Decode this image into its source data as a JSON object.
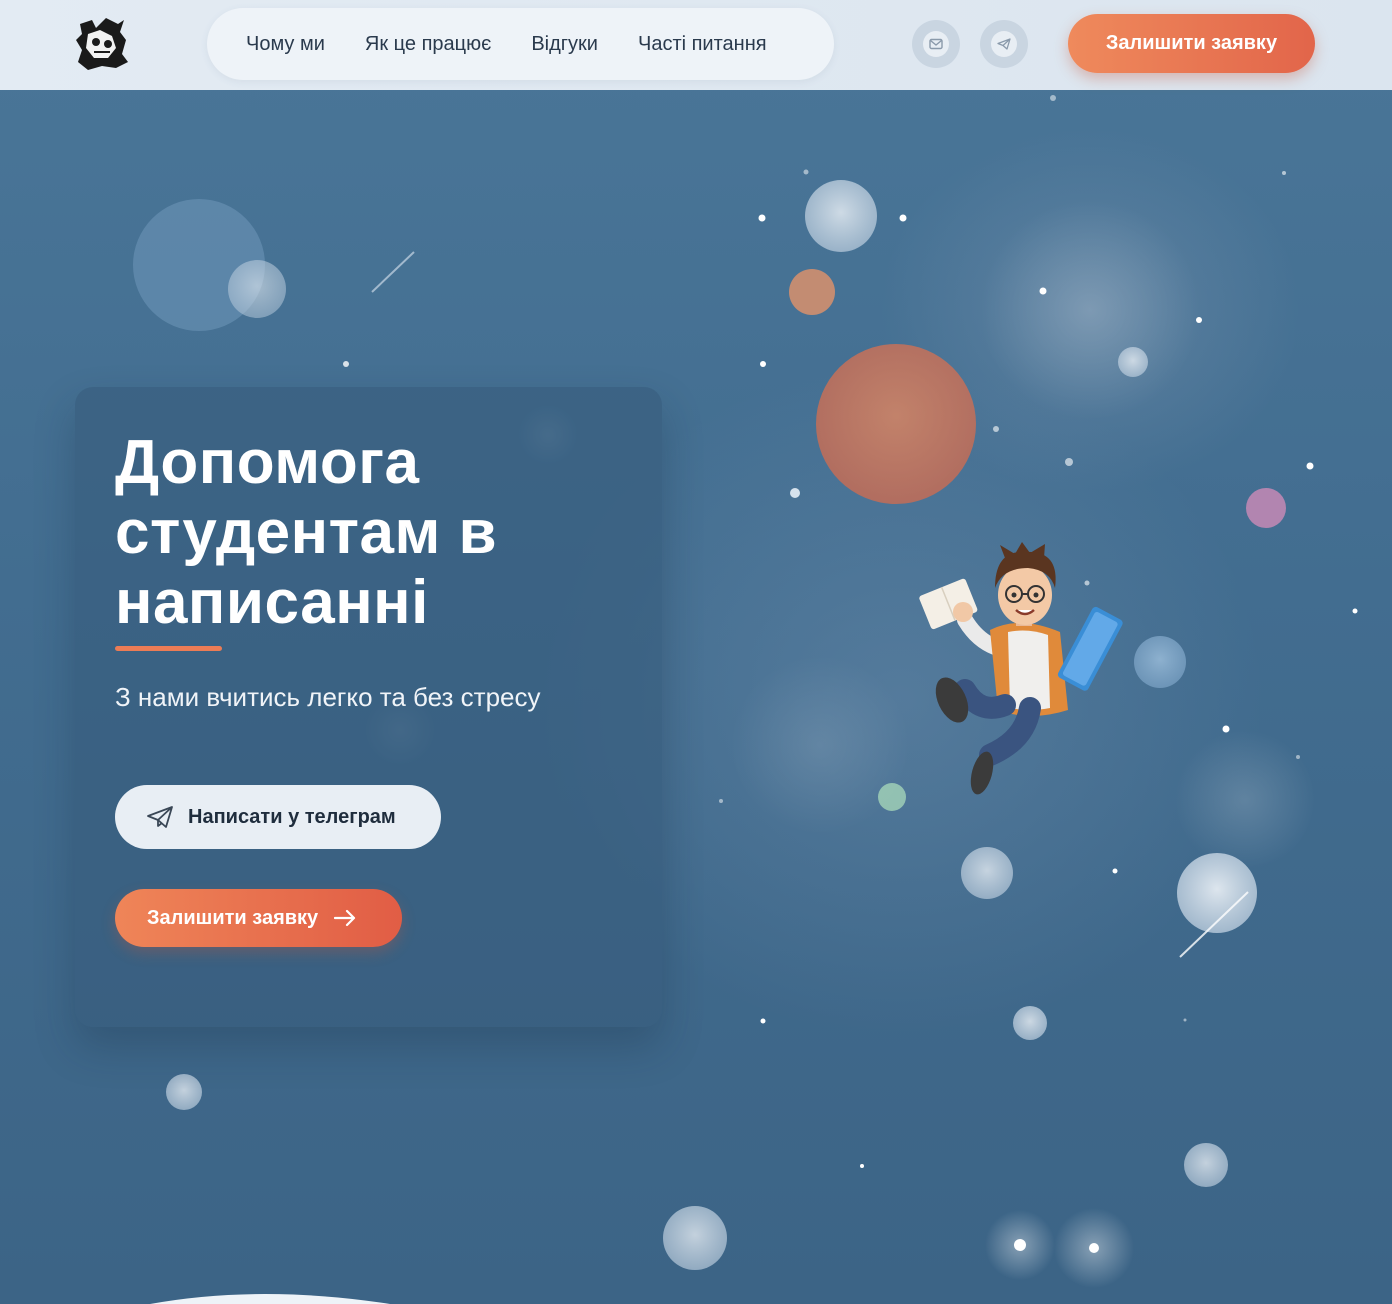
{
  "header": {
    "logo_alt": "logo",
    "nav": [
      {
        "label": "Чому ми"
      },
      {
        "label": "Як це працює"
      },
      {
        "label": "Відгуки"
      },
      {
        "label": "Часті питання"
      }
    ],
    "email_icon": "mail-icon",
    "telegram_icon": "telegram-icon",
    "cta_label": "Залишити заявку"
  },
  "hero": {
    "title": "Допомога студентам в написанні",
    "subtitle": "З нами вчитись легко та без стресу",
    "telegram_button": "Написати у телеграм",
    "request_button": "Залишити заявку"
  },
  "colors": {
    "accent": "#e8704f",
    "background": "#426d90",
    "header_bg": "#dde7f0"
  }
}
